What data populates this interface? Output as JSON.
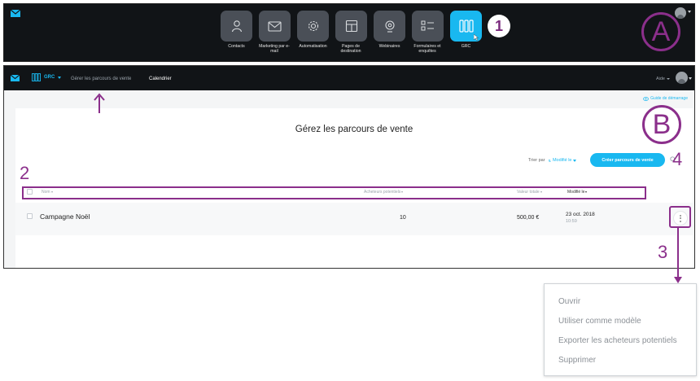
{
  "callouts": {
    "a": "A",
    "b": "B",
    "n1": "1",
    "n2": "2",
    "n3": "3",
    "n4": "4"
  },
  "app_menu": {
    "items": [
      {
        "label": "Contacts",
        "icon": "person-icon",
        "active": false
      },
      {
        "label": "Marketing par e-mail",
        "icon": "envelope-icon",
        "active": false
      },
      {
        "label": "Automatisation",
        "icon": "gear-icon",
        "active": false
      },
      {
        "label": "Pages de destination",
        "icon": "layout-icon",
        "active": false
      },
      {
        "label": "Webinaires",
        "icon": "webcam-icon",
        "active": false
      },
      {
        "label": "Formulaires et enquêtes",
        "icon": "form-list-icon",
        "active": false
      },
      {
        "label": "GRC",
        "icon": "pipeline-columns-icon",
        "active": true
      }
    ]
  },
  "topbar": {
    "app_label": "GRC",
    "nav_manage": "Gérer les parcours de vente",
    "nav_calendar": "Calendrier",
    "help_label": "Aide"
  },
  "guide_label": "Guide de démarrage",
  "main": {
    "title": "Gérez les parcours de vente",
    "sort_label": "Trier par",
    "sort_value": "Modifié le",
    "create_button": "Créer parcours de vente"
  },
  "table": {
    "headers": {
      "name": "Nom",
      "buyers": "Acheteurs potentiels",
      "value": "Valeur totale",
      "modified": "Modifié le"
    },
    "rows": [
      {
        "name": "Campagne Noël",
        "buyers": "10",
        "value": "500,00 €",
        "date": "23 oct. 2018",
        "time": "10:59"
      }
    ]
  },
  "dropdown": {
    "items": [
      "Ouvrir",
      "Utiliser comme modèle",
      "Exporter les acheteurs potentiels",
      "Supprimer"
    ]
  },
  "colors": {
    "accent": "#19b8f0",
    "annotation": "#8b2f8b",
    "dark_bar": "#111417"
  }
}
